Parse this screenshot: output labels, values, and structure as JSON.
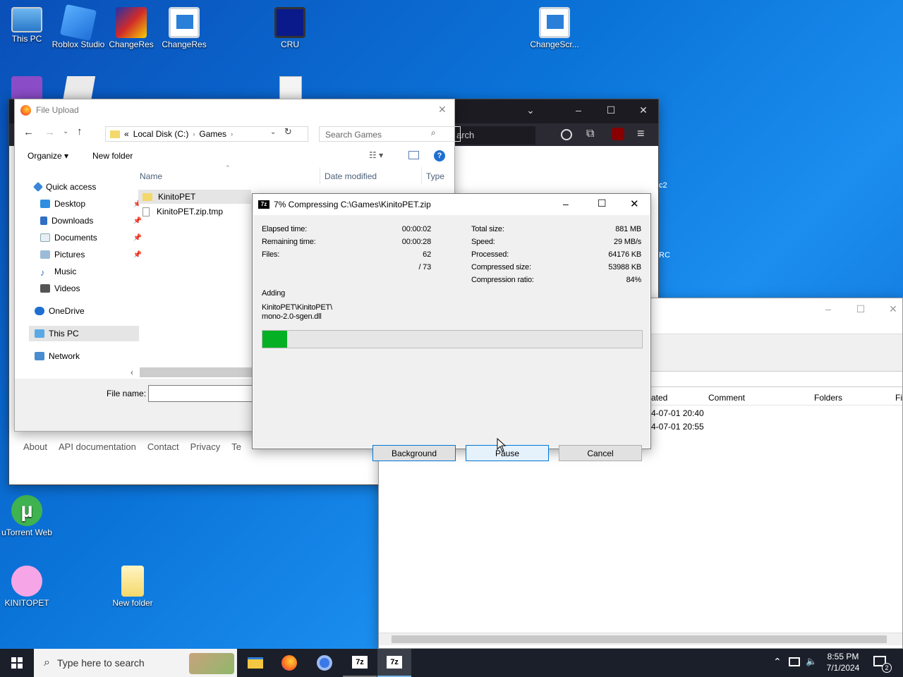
{
  "desktop": {
    "icons": [
      {
        "label": "This PC"
      },
      {
        "label": "Roblox Studio"
      },
      {
        "label": "ChangeRes"
      },
      {
        "label": "ChangeRes"
      },
      {
        "label": "CRU"
      },
      {
        "label": "ChangeScr..."
      },
      {
        "label": "uTorrent Web"
      },
      {
        "label": "KINITOPET"
      },
      {
        "label": "New folder"
      }
    ],
    "partial_labels": [
      "c2",
      "RC"
    ]
  },
  "firefox": {
    "url_fragment": "arch",
    "footer_links": [
      "About",
      "API documentation",
      "Contact",
      "Privacy",
      "Te"
    ]
  },
  "file_upload": {
    "title": "File Upload",
    "address": {
      "prefix": "«",
      "segments": [
        "Local Disk (C:)",
        "Games"
      ]
    },
    "search_placeholder": "Search Games",
    "toolbar": {
      "organize": "Organize",
      "new_folder": "New folder"
    },
    "nav": {
      "quick_access": "Quick access",
      "items": [
        "Desktop",
        "Downloads",
        "Documents",
        "Pictures",
        "Music",
        "Videos"
      ],
      "onedrive": "OneDrive",
      "this_pc": "This PC",
      "network": "Network"
    },
    "columns": {
      "name": "Name",
      "date": "Date modified",
      "type": "Type"
    },
    "files": [
      {
        "name": "KinitoPET"
      },
      {
        "name": "KinitoPET.zip.tmp"
      }
    ],
    "file_name_label": "File name:"
  },
  "zip_dialog": {
    "title": "7% Compressing C:\\Games\\KinitoPET.zip",
    "left_labels": [
      "Elapsed time:",
      "Remaining time:",
      "Files:"
    ],
    "left_values": [
      "00:00:02",
      "00:00:28",
      "62",
      "/ 73"
    ],
    "right_labels": [
      "Total size:",
      "Speed:",
      "Processed:",
      "Compressed size:",
      "Compression ratio:"
    ],
    "right_values": [
      "881 MB",
      "29 MB/s",
      "64176 KB",
      "53988 KB",
      "84%"
    ],
    "adding_label": "Adding",
    "current_path": "KinitoPET\\KinitoPET\\",
    "current_file": "mono-2.0-sgen.dll",
    "progress": 0.065,
    "buttons": {
      "background": "Background",
      "pause": "Pause",
      "cancel": "Cancel"
    }
  },
  "bg_7z": {
    "columns": [
      "ated",
      "Comment",
      "Folders",
      "Fi"
    ],
    "rows": [
      "4-07-01 20:40",
      "4-07-01 20:55"
    ]
  },
  "taskbar": {
    "search_placeholder": "Type here to search",
    "clock_time": "8:55 PM",
    "clock_date": "7/1/2024",
    "notif_count": "2",
    "apps": [
      "File Explorer",
      "Firefox",
      "Chrome",
      "7z",
      "7z"
    ]
  },
  "colors": {
    "progress_green": "#06b025",
    "accent": "#0078d7"
  }
}
